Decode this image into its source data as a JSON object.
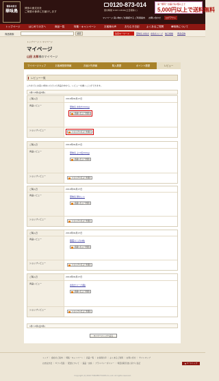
{
  "header": {
    "logo": "華味鳥",
    "tagline_1": "博多の食文化を",
    "tagline_2": "ご家庭の食卓にお届けします",
    "phone": "0120-873-014",
    "phone_note": "受付時間 9:00〜18:00(土日祝除く)",
    "ship_top": "第一類同一お届け先2個以上で",
    "ship_main": "5,000円以上で送料無料",
    "util": [
      "マイページ",
      "買い物かごを確認する",
      "ご利用案内",
      "お問い合わせ",
      "ログアウト"
    ]
  },
  "nav": [
    "トップページ",
    "はじめての方へ",
    "商品一覧",
    "特集・キャンペーン",
    "お客様の声",
    "おもむき日記",
    "よくあるご質問",
    "華味鳥について"
  ],
  "search": {
    "label": "商品検索",
    "button": "検索",
    "rec_label": "注目キーワード",
    "keywords": [
      "華味鳥 水炊き",
      "水炊きスープ",
      "柚子胡椒",
      "博多名物"
    ]
  },
  "breadcrumb": "トップページ ＞ マイページ",
  "page_title": "マイページ",
  "user": {
    "name": "山田 太郎",
    "suffix": "様のマイページ"
  },
  "tabs": [
    "マイページトップ",
    "お客様登録情報",
    "お届け先情報",
    "購入履歴",
    "ポイント履歴",
    "レビュー"
  ],
  "panel": {
    "title": "レビュー一覧",
    "note": "これまでにお買い求めいただいた商品の中から、レビューを書くことができます。",
    "pager": "1件〜5件(全5件)"
  },
  "reviews": [
    {
      "date_label": "ご購入日",
      "date": "2010年09月17日",
      "prod_label": "商品レビュー",
      "product": "華味鳥 水炊き(500g)",
      "btn": "商品レビューを書く",
      "shop_label": "ショップレビュー",
      "shop_btn": "ショップレビューを書く"
    },
    {
      "date_label": "ご購入日",
      "date": "2010年09月17日",
      "prod_label": "商品レビュー",
      "product": "華味鳥 ぶつ切(500g)",
      "btn": "商品レビューを書く",
      "shop_label": "ショップレビュー",
      "shop_btn": "ショップレビューを書く"
    },
    {
      "date_label": "ご購入日",
      "date": "2010年09月17日",
      "prod_label": "商品レビュー",
      "product": "華味鳥 鍋セット",
      "btn": "商品レビューを書く",
      "shop_label": "ショップレビュー",
      "shop_btn": "ショップレビューを書く"
    },
    {
      "date_label": "ご購入日",
      "date": "2010年09月17日",
      "prod_label": "商品レビュー",
      "product": "鶏蔵スープ(1本)",
      "btn": "商品レビューを書く",
      "shop_label": "ショップレビュー",
      "shop_btn": "ショップレビューを書く"
    },
    {
      "date_label": "ご購入日",
      "date": "2010年09月17日",
      "prod_label": "商品レビュー",
      "product": "水炊きスープ(箱)",
      "btn": "商品レビューを書く",
      "shop_label": "ショップレビュー",
      "shop_btn": "ショップレビューを書く"
    }
  ],
  "bottom_pager": "1件〜5件(全5件)",
  "mypage_btn": "マイページトップへ戻る",
  "footer": {
    "links1": [
      "トップ",
      "会社のご案内",
      "特集・キャンペーン",
      "商品一覧",
      "お客様の声",
      "よくあるご質問",
      "お問い合せ",
      "サイトマップ"
    ],
    "links2": [
      "お支払方法",
      "ギフト包装",
      "配送について",
      "返品・交換",
      "プライバシーポリシー",
      "特定商取引法に基づく表記"
    ],
    "top": "▲ ページトップ",
    "copy": "Copyright (C) 2010 TORIZEN FOODS Co.,Ltd. All rights reserved."
  }
}
